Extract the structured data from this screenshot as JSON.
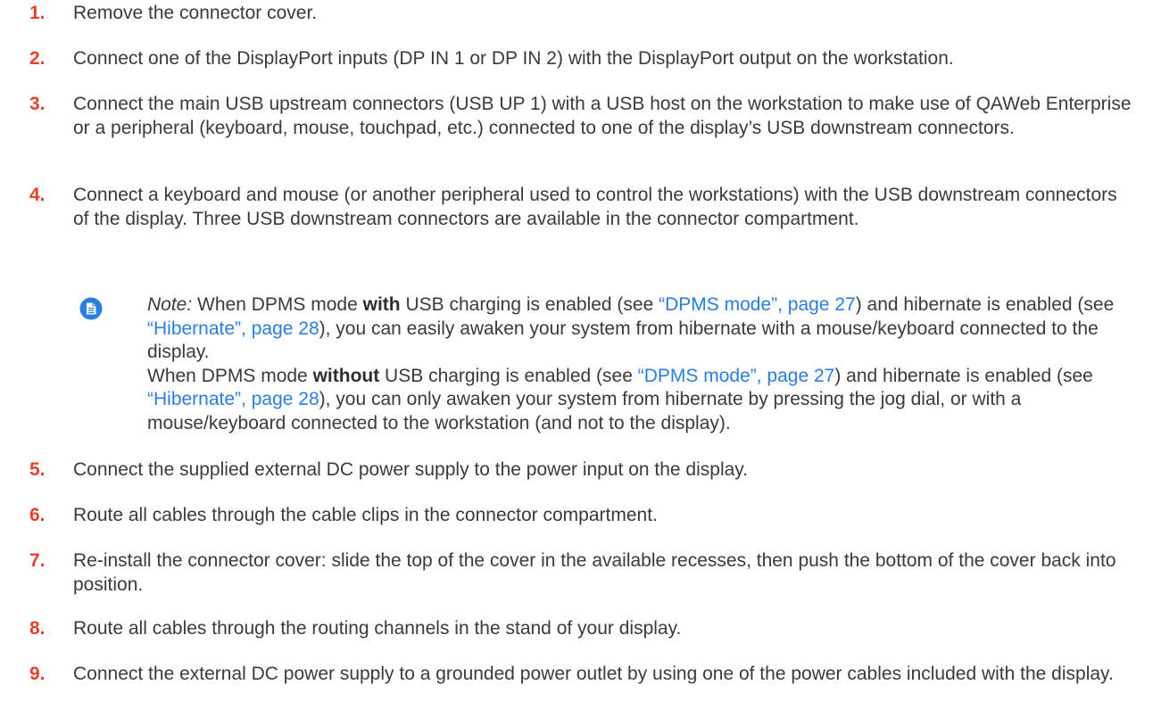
{
  "steps": [
    {
      "num": "1.",
      "text": "Remove the connector cover."
    },
    {
      "num": "2.",
      "text": "Connect one of the DisplayPort inputs (DP IN 1 or DP IN 2) with the DisplayPort output on the workstation."
    },
    {
      "num": "3.",
      "text": "Connect the main USB upstream connectors (USB UP 1) with a USB host on the workstation to make use of QAWeb Enterprise or a peripheral (keyboard, mouse, touchpad, etc.) connected to one of the display’s USB downstream connectors."
    },
    {
      "num": "4.",
      "text": "Connect a keyboard and mouse (or another peripheral used to control the workstations) with the USB downstream connectors of the display. Three USB downstream connectors are available in the connector compartment."
    },
    {
      "num": "5.",
      "text": "Connect the supplied external DC power supply to the power input on the display."
    },
    {
      "num": "6.",
      "text": "Route all cables through the cable clips in the connector compartment."
    },
    {
      "num": "7.",
      "text": "Re-install the connector cover: slide the top of the cover in the available recesses, then push the bottom of the cover back into position."
    },
    {
      "num": "8.",
      "text": "Route all cables through the routing channels in the stand of your display."
    },
    {
      "num": "9.",
      "text": "Connect the external DC power supply to a grounded power outlet by using one of the power cables included with the display."
    }
  ],
  "note": {
    "icon": "note-icon",
    "label": "Note:",
    "p1": {
      "a": " When DPMS mode ",
      "b": "with",
      "c": " USB charging is enabled (see ",
      "link1": "“DPMS mode”, page 27",
      "d": ") and hibernate is enabled (see ",
      "link2": "“Hibernate”, page 28",
      "e": "), you can easily awaken your system from hibernate with a mouse/keyboard connected to the display."
    },
    "p2": {
      "a": "When DPMS mode ",
      "b": "without",
      "c": " USB charging is enabled (see ",
      "link1": "“DPMS mode”, page 27",
      "d": ") and hibernate is enabled (see ",
      "link2": "“Hibernate”, page 28",
      "e": "), you can only awaken your system from hibernate by pressing the jog dial, or with a mouse/keyboard connected to the workstation (and not to the display)."
    }
  },
  "colors": {
    "step_number": "#e8402c",
    "link": "#2a7de1",
    "icon": "#2a7de1",
    "text": "#3a3a3a"
  }
}
